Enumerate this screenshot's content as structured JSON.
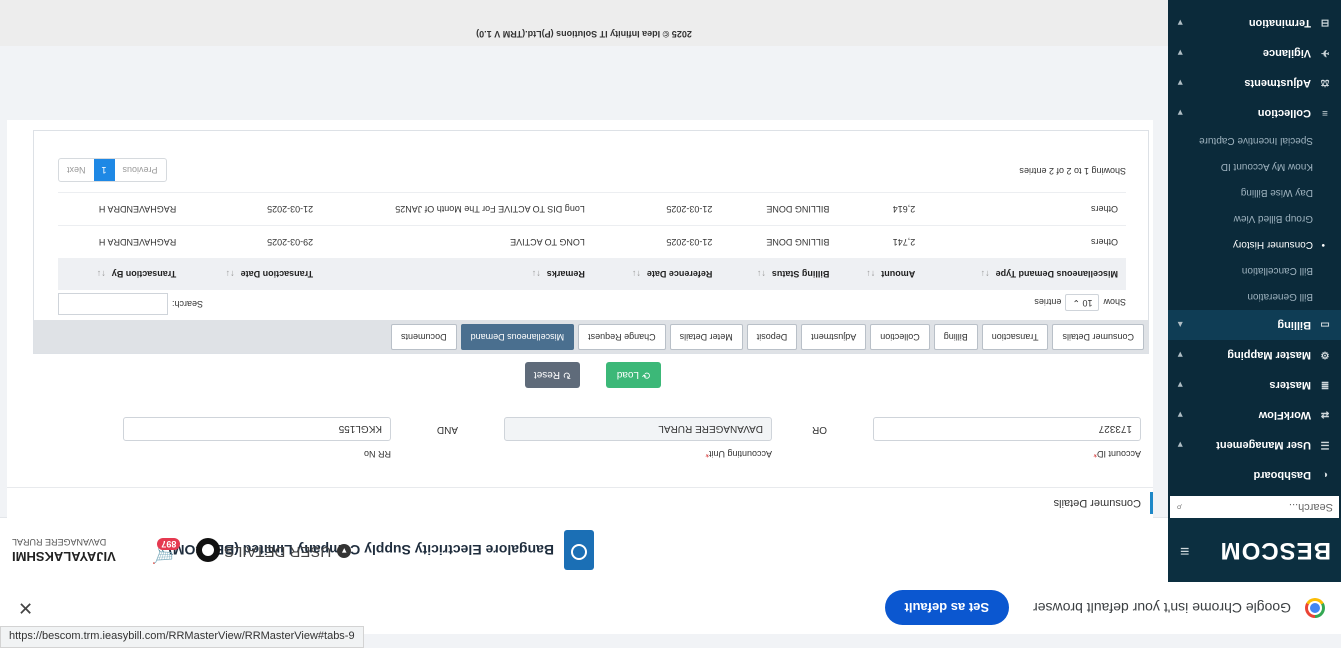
{
  "chrome_bar": {
    "message": "Google Chrome isn't your default browser",
    "set_default": "Set as default",
    "close": "✕"
  },
  "sidebar": {
    "brand": "BESCOM",
    "hamburger": "≡",
    "search_placeholder": "Search...",
    "items": [
      {
        "label": "Dashboard",
        "icon": "dashboard-icon"
      },
      {
        "label": "User Management",
        "icon": "users-icon"
      },
      {
        "label": "WorkFlow",
        "icon": "workflow-icon"
      },
      {
        "label": "Masters",
        "icon": "masters-icon"
      },
      {
        "label": "Master Mapping",
        "icon": "mapping-icon"
      },
      {
        "label": "Billing",
        "icon": "billing-icon"
      },
      {
        "label": "Collection",
        "icon": "collection-icon"
      },
      {
        "label": "Adjustments",
        "icon": "adjustments-icon"
      },
      {
        "label": "Vigilance",
        "icon": "vigilance-icon"
      },
      {
        "label": "Termination",
        "icon": "termination-icon"
      }
    ],
    "billing_sub": [
      "Bill Generation",
      "Bill Cancellation",
      "Consumer History",
      "Group Billed View",
      "Day Wise Billing",
      "Know My Account ID",
      "Special Incentive Capture"
    ]
  },
  "header": {
    "company": "Bangalore Electricity Supply Company Limited (BESCOM)",
    "user_details": "USER DETAILS",
    "cart_badge": "897",
    "user_name": "VIJAYALAKSHMI",
    "user_unit": "DAVANAGERE RURAL"
  },
  "consumer": {
    "title": "Consumer Details",
    "account_id_label": "Account ID",
    "account_id": "173327",
    "or": "OR",
    "accounting_unit_label": "Accounting Unit",
    "accounting_unit": "DAVANAGERE RURAL",
    "and": "AND",
    "rr_label": "RR No",
    "rr_no": "KKGL155",
    "load": "Load",
    "reset": "Reset"
  },
  "tabs": [
    "Consumer Details",
    "Transaction",
    "Billing",
    "Collection",
    "Adjustment",
    "Deposit",
    "Meter Details",
    "Change Request",
    "Miscellaneous Demand",
    "Documents"
  ],
  "table": {
    "show_label": "Show",
    "entries_value": "10",
    "entries_label": "entries",
    "search_label": "Search:",
    "columns": [
      "Miscellaneous Demand Type",
      "Amount",
      "Billing Status",
      "Reference Date",
      "Remarks",
      "Transaction Date",
      "Transaction By"
    ],
    "rows": [
      [
        "Others",
        "2,741",
        "BILLING DONE",
        "21-03-2025",
        "LONG TO ACTIVE",
        "29-03-2025",
        "RAGHAVENDRA H"
      ],
      [
        "Others",
        "2,614",
        "BILLING DONE",
        "21-03-2025",
        "Long DIS TO ACTIVE For The Month Of JAN25",
        "21-03-2025",
        "RAGHAVENDRA H"
      ]
    ],
    "info": "Showing 1 to 2 of 2 entries",
    "previous": "Previous",
    "page": "1",
    "next": "Next"
  },
  "footer": "2025 © Idea Infinity IT Solutions (P)Ltd.(TRM V 1.0)",
  "status_url": "https://bescom.trm.ieasybill.com/RRMasterView/RRMasterView#tabs-9"
}
